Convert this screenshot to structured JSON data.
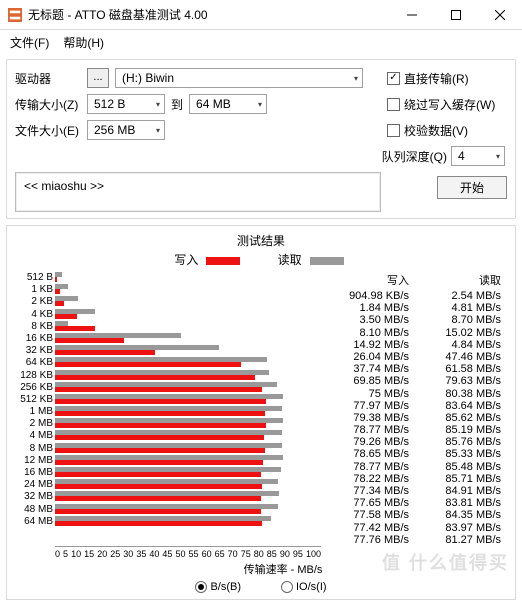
{
  "titlebar": {
    "title": "无标题 - ATTO 磁盘基准测试 4.00"
  },
  "menu": {
    "file": "文件(F)",
    "help": "帮助(H)"
  },
  "form": {
    "drive_label": "驱动器",
    "drive_value": "(H:) Biwin",
    "xfer_label": "传输大小(Z)",
    "xfer_from": "512 B",
    "xfer_to_lbl": "到",
    "xfer_to": "64 MB",
    "filesize_label": "文件大小(E)",
    "filesize_value": "256 MB",
    "direct": "直接传输(R)",
    "bypass": "绕过写入缓存(W)",
    "verify": "校验数据(V)",
    "qd_label": "队列深度(Q)",
    "qd_value": "4",
    "start": "开始",
    "desc": "<< miaoshu >>"
  },
  "chart_title": "测试结果",
  "legend": {
    "write": "写入",
    "read": "读取"
  },
  "headers": {
    "write": "写入",
    "read": "读取"
  },
  "chart_data": {
    "type": "bar",
    "xlabel": "传输速率 - MB/s",
    "xticks": [
      0,
      5,
      10,
      15,
      20,
      25,
      30,
      35,
      40,
      45,
      50,
      55,
      60,
      65,
      70,
      75,
      80,
      85,
      90,
      95,
      100
    ],
    "xmax": 100,
    "categories": [
      "512 B",
      "1 KB",
      "2 KB",
      "4 KB",
      "8 KB",
      "16 KB",
      "32 KB",
      "64 KB",
      "128 KB",
      "256 KB",
      "512 KB",
      "1 MB",
      "2 MB",
      "4 MB",
      "8 MB",
      "12 MB",
      "16 MB",
      "24 MB",
      "32 MB",
      "48 MB",
      "64 MB"
    ],
    "series": [
      {
        "name": "写入",
        "values": [
          0.905,
          1.84,
          3.5,
          8.1,
          14.92,
          26.04,
          37.74,
          69.85,
          75,
          77.97,
          79.38,
          78.77,
          79.26,
          78.65,
          78.77,
          78.22,
          77.34,
          77.65,
          77.58,
          77.42,
          77.76
        ]
      },
      {
        "name": "读取",
        "values": [
          2.54,
          4.81,
          8.7,
          15.02,
          4.84,
          47.46,
          61.58,
          79.63,
          80.38,
          83.64,
          85.62,
          85.19,
          85.76,
          85.33,
          85.48,
          85.71,
          84.91,
          83.81,
          84.35,
          83.97,
          81.27
        ]
      }
    ],
    "display": [
      {
        "w": "904.98 KB/s",
        "r": "2.54 MB/s"
      },
      {
        "w": "1.84 MB/s",
        "r": "4.81 MB/s"
      },
      {
        "w": "3.50 MB/s",
        "r": "8.70 MB/s"
      },
      {
        "w": "8.10 MB/s",
        "r": "15.02 MB/s"
      },
      {
        "w": "14.92 MB/s",
        "r": "4.84 MB/s"
      },
      {
        "w": "26.04 MB/s",
        "r": "47.46 MB/s"
      },
      {
        "w": "37.74 MB/s",
        "r": "61.58 MB/s"
      },
      {
        "w": "69.85 MB/s",
        "r": "79.63 MB/s"
      },
      {
        "w": "75 MB/s",
        "r": "80.38 MB/s"
      },
      {
        "w": "77.97 MB/s",
        "r": "83.64 MB/s"
      },
      {
        "w": "79.38 MB/s",
        "r": "85.62 MB/s"
      },
      {
        "w": "78.77 MB/s",
        "r": "85.19 MB/s"
      },
      {
        "w": "79.26 MB/s",
        "r": "85.76 MB/s"
      },
      {
        "w": "78.65 MB/s",
        "r": "85.33 MB/s"
      },
      {
        "w": "78.77 MB/s",
        "r": "85.48 MB/s"
      },
      {
        "w": "78.22 MB/s",
        "r": "85.71 MB/s"
      },
      {
        "w": "77.34 MB/s",
        "r": "84.91 MB/s"
      },
      {
        "w": "77.65 MB/s",
        "r": "83.81 MB/s"
      },
      {
        "w": "77.58 MB/s",
        "r": "84.35 MB/s"
      },
      {
        "w": "77.42 MB/s",
        "r": "83.97 MB/s"
      },
      {
        "w": "77.76 MB/s",
        "r": "81.27 MB/s"
      }
    ]
  },
  "radio": {
    "bs": "B/s(B)",
    "ios": "IO/s(I)"
  },
  "watermark": "值 什么值得买"
}
